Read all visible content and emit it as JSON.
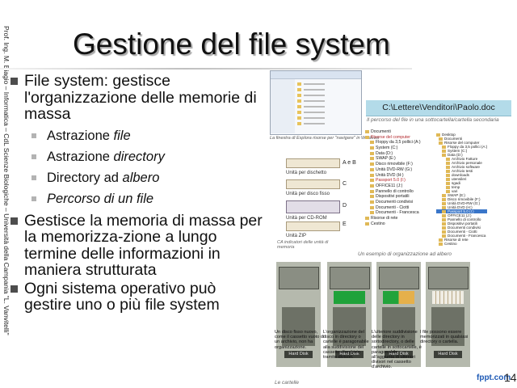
{
  "sidebar": {
    "author_line": "Prof. Ing. M. Biagio – Informatica – CdL Scienze Biologiche – Università della Campania \"L. Vanvitelli\""
  },
  "slide": {
    "title": "Gestione del file system",
    "bullet1": "File system: gestisce l'organizzazione delle memorie di massa",
    "sub1": {
      "prefix": "Astrazione ",
      "em": "file"
    },
    "sub2": {
      "prefix": "Astrazione ",
      "em": "directory"
    },
    "sub3": {
      "prefix": "Directory ad ",
      "em": "albero"
    },
    "sub4": {
      "prefix": "",
      "em": "Percorso di un file"
    },
    "bullet2": "Gestisce la memoria di massa per la memorizza-zione a lungo termine delle informazioni in maniera strutturata",
    "bullet3": "Ogni sistema operativo può gestire uno o più file system"
  },
  "figures": {
    "explorer_caption": "La finestra di Esplora risorse per \"navigare\" in Windows",
    "path": "C:\\Lettere\\Venditori\\Paolo.doc",
    "path_caption": "Il percorso del file in una sottocartella/cartella secondaria",
    "drives": [
      {
        "label": "Unità per dischetto",
        "letter": "A e B"
      },
      {
        "label": "Unità per disco fisso",
        "letter": "C"
      },
      {
        "label": "Unità per CD-ROM",
        "letter": "D"
      },
      {
        "label": "Unità ZIP",
        "letter": "E"
      }
    ],
    "drives_caption": "CA indicatori delle unità di memoria",
    "tree_caption": "Un esempio di organizzazione ad albero",
    "tree_left": [
      "Documenti",
      "Risorse del computer",
      "Floppy da 3,5 pollici (A:)",
      "System (C:)",
      "Data (D:)",
      "SWAP (E:)",
      "Disco rimovibile (F:)",
      "Unità DVD-RW (G:)",
      "Unità DVD (H:)",
      "Passport 5.0 (I:)",
      "OFFICE11 (J:)",
      "Pannello di controllo",
      "Dispositivi portatili",
      "Documenti condivisi",
      "Documenti - Ciotti",
      "Documenti - Francesca",
      "Risorse di rete",
      "Cestino"
    ],
    "tree_right": [
      "Desktop",
      "Documenti",
      "Risorse del computer",
      "Floppy da 3,5 pollici (A:)",
      "System (C:)",
      "Data (D:)",
      "Archivio Fatture",
      "Archivio personale",
      "Archivio software",
      "Archivio testi",
      "downloads",
      "utensileri",
      "sgadi",
      "temp",
      "vari",
      "SWAP (E:)",
      "Disco rimovibile (F:)",
      "Unità DVD-RW (G:)",
      "Unità DVD (H:)",
      "Passport 5.0 (I:)",
      "OFFICE11 (J:)",
      "Pannello di controllo",
      "Dispositivi portatili",
      "Documenti condivisi",
      "Documenti - Ciotti",
      "Documenti - Francesca",
      "Risorse di rete",
      "Cestino"
    ],
    "cabinet_label": "Hard Disk",
    "cabinet_descs": [
      "Un disco fisso nuovo, come il cassetto vuoto di un archivio, non ha organizzazione.",
      "L'organizzazione del disco in directory o cartelle è paragonabile alla suddivisione del cassetto d'archivio tramite divisori.",
      "L'ulteriore suddivisione delle directory in sottodirectory, o delle cartelle in sottocartelle, è paragonabile all'aggiunta di ulteriori divisori nel cassetto d'archivio.",
      "I file possono essere memorizzati in qualsiasi directory o cartella."
    ],
    "cabinets_caption": "Le cartelle"
  },
  "footer": {
    "brand": "fppt.com",
    "page": "14"
  }
}
